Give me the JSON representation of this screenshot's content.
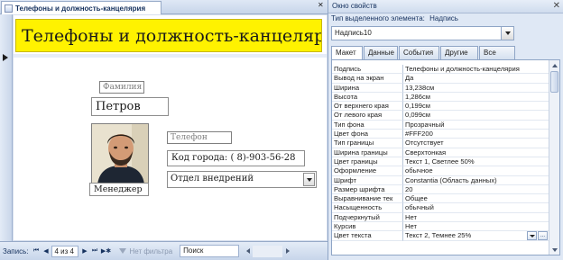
{
  "form_window": {
    "tab_title": "Телефоны и должность-канцелярия",
    "close_glyph": "✕",
    "form_title": "Телефоны и должность-канцелярия",
    "fields": {
      "lastname_label": "Фамилия",
      "lastname_value": "Петров",
      "phone_label": "Телефон",
      "phone_value": "Код города: ( 8)-903-56-28",
      "position_value": "Менеджер",
      "department_value": "Отдел внедрений"
    }
  },
  "navbar": {
    "record_label": "Запись:",
    "first_glyph": "⏮",
    "prev_glyph": "◀",
    "position": "4 из 4",
    "next_glyph": "▶",
    "last_glyph": "⏭",
    "new_glyph": "▶✱",
    "filter_label": "Нет фильтра",
    "search_value": "Поиск"
  },
  "property_sheet": {
    "title": "Окно свойств",
    "close_glyph": "✕",
    "selection_type_label": "Тип выделенного элемента:",
    "selection_type_value": "Надпись",
    "selected_object": "Надпись10",
    "tabs": [
      "Макет",
      "Данные",
      "События",
      "Другие",
      "Все"
    ],
    "active_tab": "Макет",
    "builder_glyph": "...",
    "properties": [
      {
        "name": "Подпись",
        "value": "Телефоны и должность-канцелярия"
      },
      {
        "name": "Вывод на экран",
        "value": "Да"
      },
      {
        "name": "Ширина",
        "value": "13,238см"
      },
      {
        "name": "Высота",
        "value": "1,286см"
      },
      {
        "name": "От верхнего края",
        "value": "0,199см"
      },
      {
        "name": "От левого края",
        "value": "0,099см"
      },
      {
        "name": "Тип фона",
        "value": "Прозрачный"
      },
      {
        "name": "Цвет фона",
        "value": "#FFF200"
      },
      {
        "name": "Тип границы",
        "value": "Отсутствует"
      },
      {
        "name": "Ширина границы",
        "value": "Сверхтонкая"
      },
      {
        "name": "Цвет границы",
        "value": "Текст 1, Светлее 50%"
      },
      {
        "name": "Оформление",
        "value": "обычное"
      },
      {
        "name": "Шрифт",
        "value": "Constantia (Область данных)"
      },
      {
        "name": "Размер шрифта",
        "value": "20"
      },
      {
        "name": "Выравнивание тек",
        "value": "Общее"
      },
      {
        "name": "Насыщенность",
        "value": "обычный"
      },
      {
        "name": "Подчеркнутый",
        "value": "Нет"
      },
      {
        "name": "Курсив",
        "value": "Нет"
      },
      {
        "name": "Цвет текста",
        "value": "Текст 2, Темнее 25%"
      }
    ]
  },
  "colors": {
    "title_background": "#FFF200",
    "access_frame": "#D6DFEE"
  }
}
